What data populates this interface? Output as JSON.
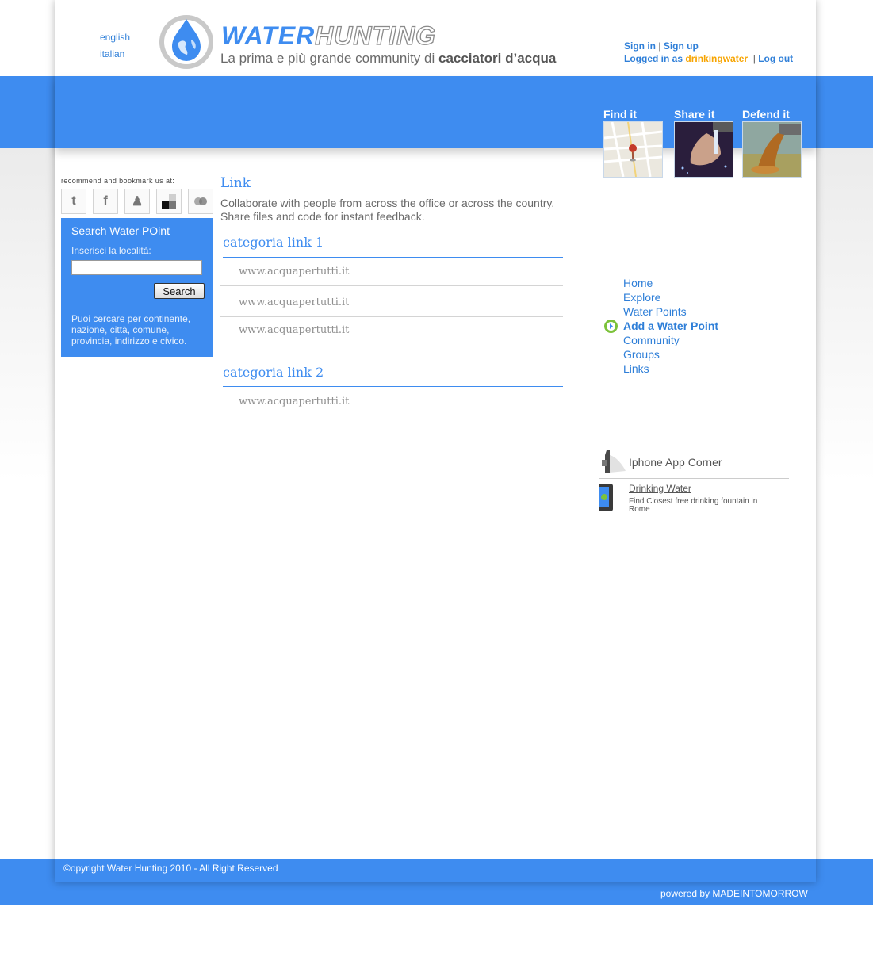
{
  "languages": [
    "english",
    "italian"
  ],
  "logo": {
    "word_1": "WATER",
    "word_2": "HUNTING",
    "tagline_plain": "La prima e più grande community di ",
    "tagline_bold": "cacciatori d’acqua"
  },
  "auth": {
    "sign_in": "Sign in",
    "sign_up": "Sign up",
    "separator": "|",
    "logged_in_as": "Logged in as",
    "username": "drinkingwater",
    "log_out": "Log out"
  },
  "promos": [
    {
      "label": "Find it"
    },
    {
      "label": "Share it"
    },
    {
      "label": "Defend it"
    }
  ],
  "bookmark": {
    "label": "recommend and bookmark us at:",
    "services": [
      {
        "icon": "twitter-icon",
        "glyph": "t"
      },
      {
        "icon": "facebook-icon",
        "glyph": "f"
      },
      {
        "icon": "myspace-icon",
        "glyph": "♟"
      },
      {
        "icon": "delicious-icon",
        "glyph": ""
      },
      {
        "icon": "digg-icon",
        "glyph": "●"
      }
    ]
  },
  "search": {
    "title": "Search Water POint",
    "label": "Inserisci la località:",
    "value": "",
    "button": "Search",
    "hint": "Puoi cercare per continente, nazione, città, comune, provincia, indirizzo e civico."
  },
  "main": {
    "title": "Link",
    "intro": "Collaborate with people from across the office or across the country. Share files and code for instant feedback.",
    "categories": [
      {
        "title": "categoria link 1",
        "links": [
          "www.acquapertutti.it",
          "www.acquapertutti.it",
          "www.acquapertutti.it"
        ]
      },
      {
        "title": "categoria link 2",
        "links": [
          "www.acquapertutti.it"
        ]
      }
    ]
  },
  "nav": {
    "items": [
      "Home",
      "Explore",
      "Water Points",
      "Add a Water Point",
      "Community",
      "Groups",
      "Links"
    ],
    "active": "Add a Water Point"
  },
  "app_corner": {
    "title": "Iphone App Corner",
    "item_name": "Drinking Water",
    "item_desc": "Find Closest free drinking fountain in Rome"
  },
  "footer": {
    "copyright": "©opyright Water Hunting 2010 - All Right Reserved",
    "powered": "powered by MADEINTOMORROW"
  },
  "colors": {
    "brand_blue": "#3e8cf0",
    "link_blue": "#2f7fd8",
    "username_orange": "#f7a400"
  }
}
